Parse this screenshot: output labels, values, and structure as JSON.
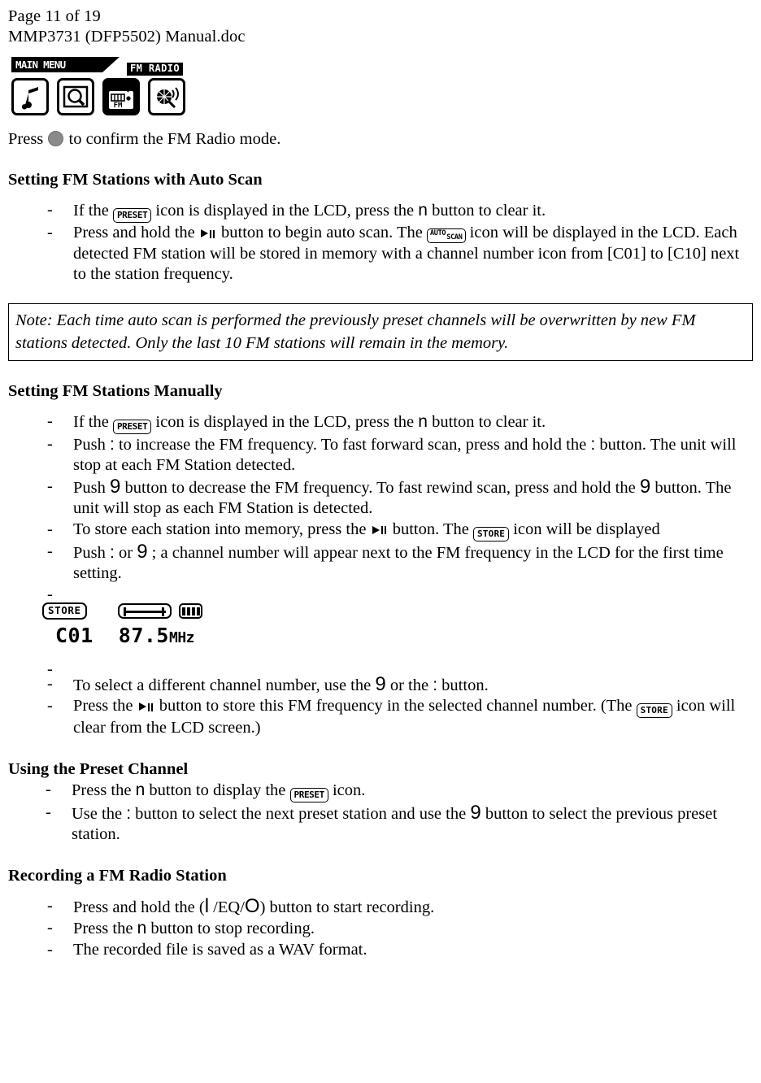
{
  "header": {
    "page_label": "Page 11 of 19",
    "doc_name": "MMP3731 (DFP5502) Manual.doc"
  },
  "main_menu_lcd": {
    "banner_label": "MAIN MENU",
    "selected_label": "FM RADIO",
    "icons": [
      {
        "name": "music-note-icon",
        "label": "Music"
      },
      {
        "name": "photo-browse-icon",
        "label": "Photo"
      },
      {
        "name": "fm-radio-icon",
        "label": "FM Radio",
        "selected": true
      },
      {
        "name": "voice-record-icon",
        "label": "Record"
      }
    ]
  },
  "intro": {
    "before_dot": "Press ",
    "after_dot": " to confirm the FM Radio mode."
  },
  "sections": {
    "auto_scan": {
      "heading": "Setting FM Stations with Auto Scan",
      "items": {
        "item1_a": "If the ",
        "item1_icon": "PRESET",
        "item1_b": " icon is displayed in the LCD, press the ",
        "item1_sym": "n",
        "item1_c": " button to clear it.",
        "item2_a": "Press and hold the ",
        "item2_b": " button to begin auto scan.  The ",
        "item2_icon_top": "AUTO",
        "item2_icon_bottom": "SCAN",
        "item2_c": " icon will be displayed in the LCD.  Each detected FM station will be stored in memory with a channel number icon from [C01] to [C10] next to the station frequency."
      }
    },
    "note": {
      "text": "Note: Each time auto scan is performed the previously preset channels will be overwritten by new FM stations detected.  Only the last 10 FM stations will remain in the memory."
    },
    "manual": {
      "heading": "Setting FM Stations Manually",
      "item1_a": "If the ",
      "item1_icon": "PRESET",
      "item1_b": " icon is displayed in the LCD, press the ",
      "item1_sym": "n",
      "item1_c": " button to clear it.",
      "item2_a": "Push ",
      "item2_sym1": ":",
      "item2_b": " to increase the FM frequency.  To fast forward scan, press and hold the  ",
      "item2_sym2": ":",
      "item2_c": " button.  The unit will stop at each FM Station detected.",
      "item3_a": "Push ",
      "item3_sym1": "9",
      "item3_b": " button to decrease the FM frequency.  To fast rewind scan, press and hold the ",
      "item3_sym2": "9",
      "item3_c": " button.  The unit will stop as each FM Station is detected.",
      "item4_a": "To store each station into memory, press the ",
      "item4_b": " button.  The ",
      "item4_icon": "STORE",
      "item4_c": " icon will be displayed",
      "item5_a": "Push ",
      "item5_sym1": ":",
      "item5_b": " or ",
      "item5_sym2": "9",
      "item5_c": " ; a channel number will appear next to the FM frequency in the LCD for the first time setting.",
      "item7_a": "To select a different channel number, use the ",
      "item7_sym1": "9",
      "item7_b": " or the ",
      "item7_sym2": ":",
      "item7_c": " button.",
      "item8_a": "Press the ",
      "item8_b": " button to store this FM frequency in the selected channel number.  (The ",
      "item8_icon": "STORE",
      "item8_c": " icon will clear from the LCD screen.)"
    },
    "preset_channel": {
      "heading": "Using the Preset Channel",
      "item1_a": "Press the ",
      "item1_sym": "n",
      "item1_b": " button to display the ",
      "item1_icon": "PRESET",
      "item1_c": " icon.",
      "item2_a": "Use the ",
      "item2_sym1": ":",
      "item2_b": " button to select the next preset station and use the ",
      "item2_sym2": "9",
      "item2_c": " button to select the previous preset station."
    },
    "recording": {
      "heading": "Recording a FM Radio Station",
      "item1_a": "Press and hold the (",
      "item1_sym1": "l",
      "item1_b": " /EQ/",
      "item1_sym2": "O",
      "item1_c": ") button to start recording.",
      "item2_a": "Press the ",
      "item2_sym": "n",
      "item2_b": " button to stop recording.",
      "item3": "The recorded file is saved as a WAV format."
    }
  },
  "status_lcd": {
    "store_label": "STORE",
    "signal_icon": "tuning-bar-icon",
    "battery_icon": "battery-full-icon",
    "battery_bars": 4,
    "channel": "C01",
    "frequency": "87.5",
    "unit": "MHz"
  }
}
